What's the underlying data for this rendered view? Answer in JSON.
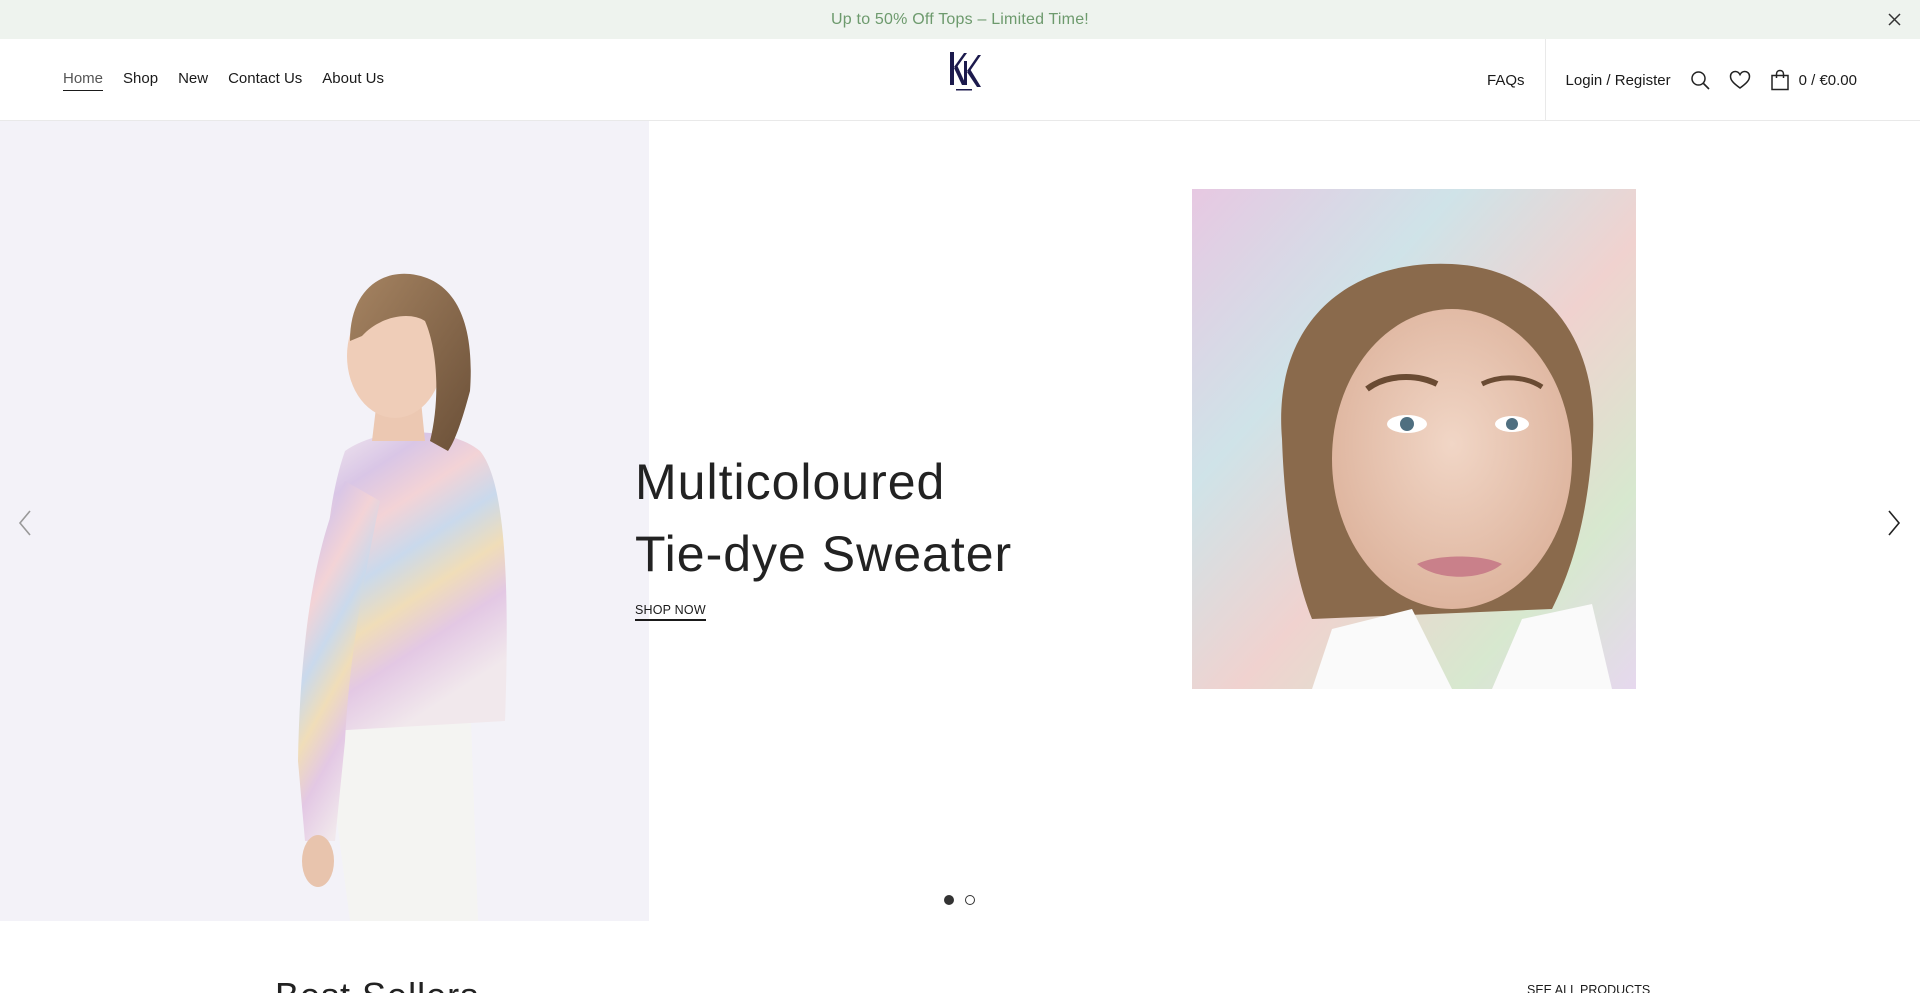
{
  "promo": {
    "text": "Up to 50% Off Tops – Limited Time!"
  },
  "nav": {
    "items": [
      {
        "label": "Home",
        "active": true
      },
      {
        "label": "Shop"
      },
      {
        "label": "New"
      },
      {
        "label": "Contact Us"
      },
      {
        "label": "About Us"
      }
    ]
  },
  "header": {
    "faqs": "FAQs",
    "login": "Login / Register",
    "cart_total": "0 / €0.00",
    "icons": [
      "search-icon",
      "heart-icon",
      "bag-icon"
    ]
  },
  "hero": {
    "title_line1": "Multicoloured",
    "title_line2": "Tie-dye Sweater",
    "cta": "SHOP NOW",
    "slides": 2,
    "active_slide": 1
  },
  "best_sellers": {
    "title": "Best Sellers",
    "see_all": "SEE ALL PRODUCTS"
  },
  "colors": {
    "promo_bg": "#eef3ee",
    "promo_text": "#6d9a6d",
    "hero_left_bg": "#f3f2f8",
    "logo_navy": "#1c1a4d"
  }
}
